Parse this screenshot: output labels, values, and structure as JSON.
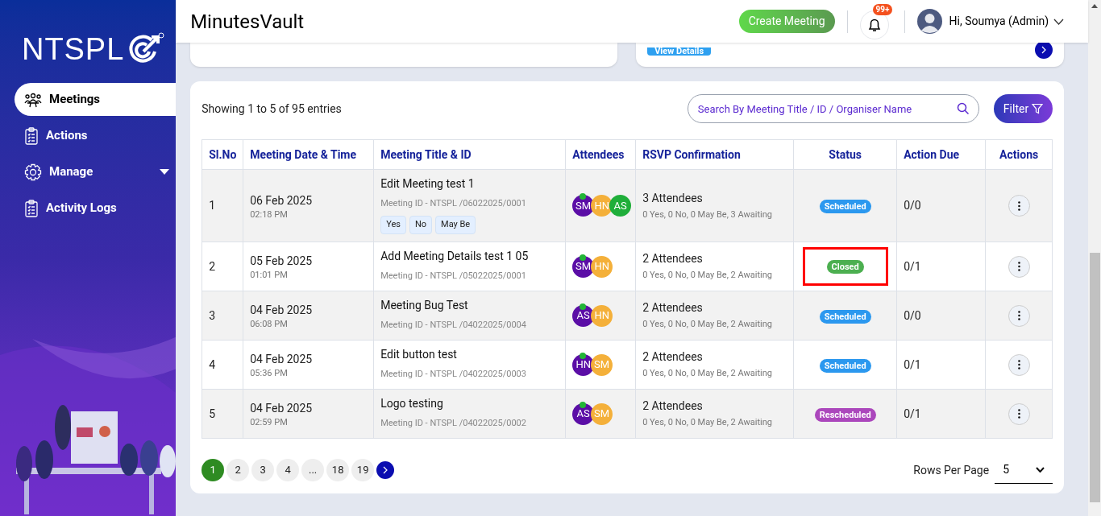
{
  "sidebar": {
    "logo": "NTSPL",
    "items": [
      {
        "label": "Meetings",
        "selected": true,
        "expandable": false
      },
      {
        "label": "Actions",
        "selected": false,
        "expandable": false
      },
      {
        "label": "Manage",
        "selected": false,
        "expandable": true
      },
      {
        "label": "Activity Logs",
        "selected": false,
        "expandable": false
      }
    ]
  },
  "header": {
    "title": "MinutesVault",
    "create_button": "Create Meeting",
    "notification_badge": "99+",
    "user": "Hi, Soumya (Admin)"
  },
  "top_cards": {
    "button": "View Details"
  },
  "table_card": {
    "summary": "Showing 1 to 5 of 95 entries",
    "search": {
      "placeholder": "Search By Meeting Title / ID / Organiser Name"
    },
    "filter_button": "Filter",
    "columns": [
      "Sl.No",
      "Meeting Date & Time",
      "Meeting Title & ID",
      "Attendees",
      "RSVP Confirmation",
      "Status",
      "Action Due",
      "Actions"
    ],
    "rows": [
      {
        "sl": "1",
        "date": "06 Feb 2025",
        "time": "02:18 PM",
        "title": "Edit Meeting test 1",
        "meeting_id": "Meeting ID - NTSPL /06022025/0001",
        "rsvp_buttons": [
          "Yes",
          "No",
          "May Be"
        ],
        "attendees": [
          {
            "initials": "SM",
            "color": "#5b0ea6"
          },
          {
            "initials": "HN",
            "color": "#f4b03a"
          },
          {
            "initials": "AS",
            "color": "#1fae3a"
          }
        ],
        "rsvp": "3 Attendees",
        "rsvp_detail": "0 Yes, 0 No, 0 May Be, 3 Awaiting",
        "status": {
          "label": "Scheduled",
          "color": "#2b98ef",
          "highlighted": false
        },
        "action_due": "0/0"
      },
      {
        "sl": "2",
        "date": "05 Feb 2025",
        "time": "01:01 PM",
        "title": "Add Meeting Details test 1 05",
        "meeting_id": "Meeting ID - NTSPL /05022025/0001",
        "attendees": [
          {
            "initials": "SM",
            "color": "#5b0ea6"
          },
          {
            "initials": "HN",
            "color": "#f4b03a"
          }
        ],
        "rsvp": "2 Attendees",
        "rsvp_detail": "0 Yes, 0 No, 0 May Be, 2 Awaiting",
        "status": {
          "label": "Closed",
          "color": "#4caf50",
          "highlighted": true
        },
        "action_due": "0/1"
      },
      {
        "sl": "3",
        "date": "04 Feb 2025",
        "time": "06:08 PM",
        "title": "Meeting Bug Test",
        "meeting_id": "Meeting ID - NTSPL /04022025/0004",
        "attendees": [
          {
            "initials": "AS",
            "color": "#5b0ea6"
          },
          {
            "initials": "HN",
            "color": "#f4b03a"
          }
        ],
        "rsvp": "2 Attendees",
        "rsvp_detail": "0 Yes, 0 No, 0 May Be, 2 Awaiting",
        "status": {
          "label": "Scheduled",
          "color": "#2b98ef",
          "highlighted": false
        },
        "action_due": "0/0"
      },
      {
        "sl": "4",
        "date": "04 Feb 2025",
        "time": "05:36 PM",
        "title": "Edit button test",
        "meeting_id": "Meeting ID - NTSPL /04022025/0003",
        "attendees": [
          {
            "initials": "HN",
            "color": "#5b0ea6"
          },
          {
            "initials": "SM",
            "color": "#f4b03a"
          }
        ],
        "rsvp": "2 Attendees",
        "rsvp_detail": "0 Yes, 0 No, 0 May Be, 2 Awaiting",
        "status": {
          "label": "Scheduled",
          "color": "#2b98ef",
          "highlighted": false
        },
        "action_due": "0/1"
      },
      {
        "sl": "5",
        "date": "04 Feb 2025",
        "time": "02:59 PM",
        "title": "Logo testing",
        "meeting_id": "Meeting ID - NTSPL /04022025/0002",
        "attendees": [
          {
            "initials": "AS",
            "color": "#5b0ea6"
          },
          {
            "initials": "SM",
            "color": "#f4b03a"
          }
        ],
        "rsvp": "2 Attendees",
        "rsvp_detail": "0 Yes, 0 No, 0 May Be, 2 Awaiting",
        "status": {
          "label": "Rescheduled",
          "color": "#ab47bc",
          "highlighted": false
        },
        "action_due": "0/1"
      }
    ],
    "pagination": [
      {
        "label": "1",
        "selected": true
      },
      {
        "label": "2",
        "selected": false
      },
      {
        "label": "3",
        "selected": false
      },
      {
        "label": "4",
        "selected": false
      },
      {
        "label": "...",
        "selected": false
      },
      {
        "label": "18",
        "selected": false
      },
      {
        "label": "19",
        "selected": false
      }
    ],
    "rows_per_page_label": "Rows Per Page",
    "rows_per_page": "5"
  }
}
